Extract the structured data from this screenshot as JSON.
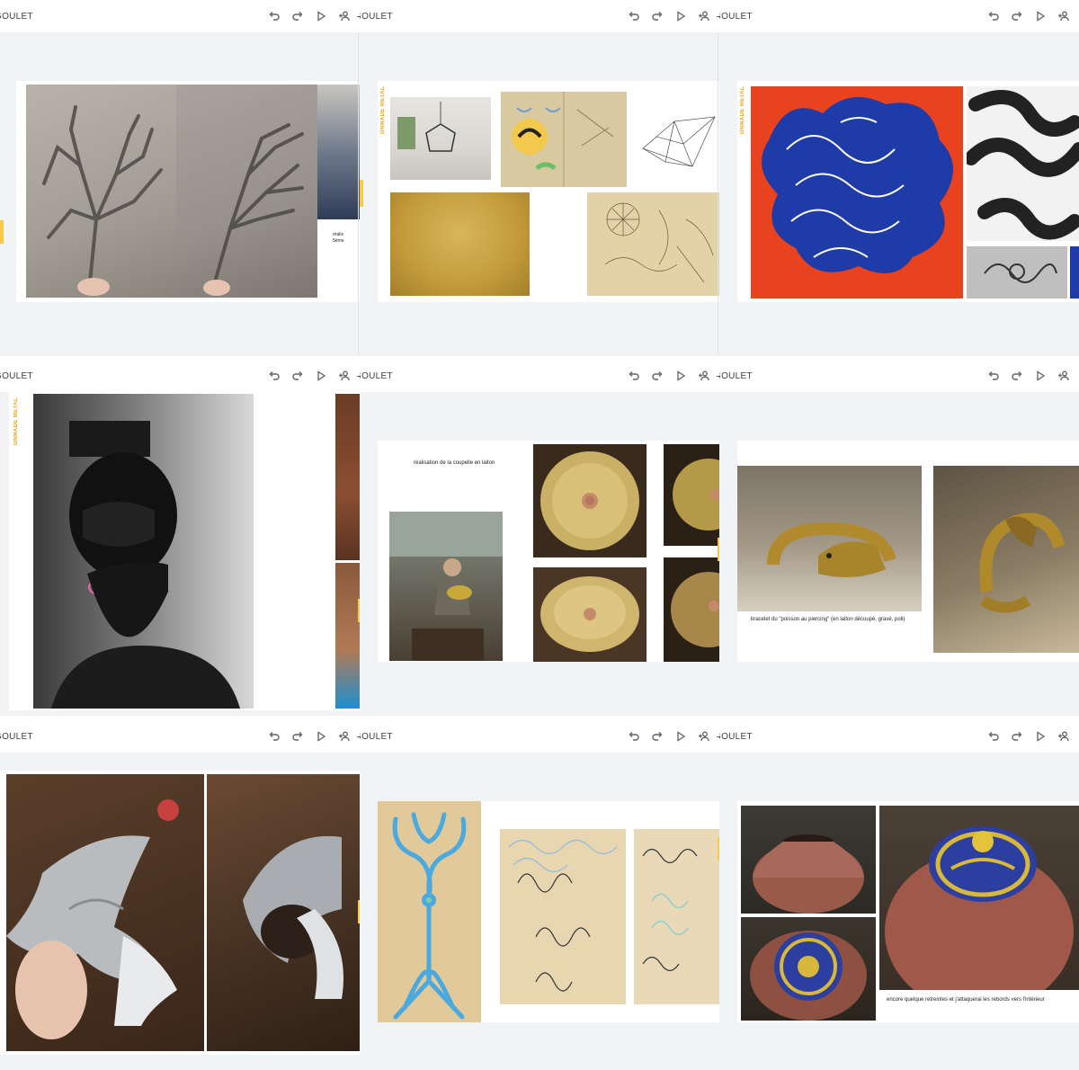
{
  "toolbar": {
    "title": "GOULET",
    "icons": [
      "undo-icon",
      "redo-icon",
      "play-icon",
      "add-person-icon"
    ]
  },
  "slides": {
    "s1": {
      "caption": "réalis\n5ème"
    },
    "s2": {
      "label": "DNMADE METAL"
    },
    "s3": {
      "label": "DNMADE METAL"
    },
    "s4": {
      "label": "DNMADE METAL"
    },
    "s5": {
      "caption": "réalisation de la coupelle en laiton"
    },
    "s6": {
      "caption": "bracelet du \"poisson au piercing\" (en laiton découpé, gravé, poli)"
    },
    "s9": {
      "caption": "encore quelque retreintes et j'attaquerai les rebords vers l'intérieur"
    }
  },
  "colors": {
    "accent": "#f0a500",
    "toolbar_bg": "#ffffff",
    "canvas_bg": "#f1f3f4"
  }
}
